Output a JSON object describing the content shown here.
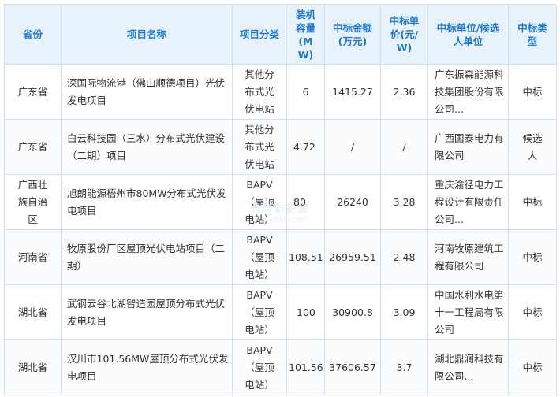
{
  "table": {
    "headers": [
      "省份",
      "项目名称",
      "项目分类",
      "装机容量(MW)",
      "中标金额(万元)",
      "中标单价(元/W)",
      "中标单位/候选人单位",
      "中标类型"
    ],
    "rows": [
      {
        "province": "广东省",
        "project": "深国际物流港（佛山顺德项目）光伏发电项目",
        "category": "其他分布式光伏电站",
        "capacity": "6",
        "amount": "1415.27",
        "price": "2.36",
        "unit": "广东振森能源科技集团股份有限公司...",
        "type": "中标"
      },
      {
        "province": "广东省",
        "project": "白云科技园（三水）分布式光伏建设（二期）项目",
        "category": "其他分布式光伏电站",
        "capacity": "4.72",
        "amount": "/",
        "price": "/",
        "unit": "广西国泰电力有限公司",
        "type": "候选人"
      },
      {
        "province": "广西壮族自治区",
        "project": "旭朗能源梧州市80MW分布式光伏发电项目",
        "category": "BAPV（屋顶电站）",
        "capacity": "80",
        "amount": "26240",
        "price": "3.28",
        "unit": "重庆渝径电力工程设计有限责任公司...",
        "type": "中标"
      },
      {
        "province": "河南省",
        "project": "牧原股份厂区屋顶光伏电站项目（二期）",
        "category": "BAPV（屋顶电站）",
        "capacity": "108.51",
        "amount": "26959.51",
        "price": "2.48",
        "unit": "河南牧原建筑工程有限公司",
        "type": "中标"
      },
      {
        "province": "湖北省",
        "project": "武钢云谷北湖智造园屋顶分布式光伏发电项目",
        "category": "BAPV（屋顶电站）",
        "capacity": "100",
        "amount": "30900.8",
        "price": "3.09",
        "unit": "中国水利水电第十一工程局有限公司",
        "type": "中标"
      },
      {
        "province": "湖北省",
        "project": "汉川市101.56MW屋顶分布式光伏发电项目",
        "category": "BAPV（屋顶电站）",
        "capacity": "101.56",
        "amount": "37606.57",
        "price": "3.7",
        "unit": "湖北鼎润科技有限公司...",
        "type": "中标"
      }
    ]
  },
  "watermark": {
    "line1": "数字新能源",
    "line2": "DataBM.com"
  }
}
